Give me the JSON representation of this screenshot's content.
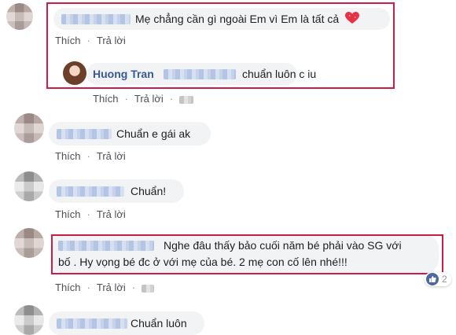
{
  "comments": [
    {
      "text": "Mẹ chẳng cần gì ngoài Em vì Em là tất cả",
      "emoji": "sparkling-heart-icon",
      "actions": {
        "like": "Thích",
        "reply": "Trả lời"
      },
      "reply": {
        "author": "Huong Tran",
        "text": "chuẩn luôn c iu",
        "actions": {
          "like": "Thích",
          "reply": "Trả lời"
        }
      }
    },
    {
      "text": "Chuẩn e gái ak",
      "actions": {
        "like": "Thích",
        "reply": "Trả lời"
      }
    },
    {
      "text": "Chuẩn!",
      "actions": {
        "like": "Thích",
        "reply": "Trả lời"
      }
    },
    {
      "text_line1": "Nghe đâu thấy bảo cuối năm bé phải vào SG với",
      "text_line2": "bố . Hy vọng bé đc ở với mẹ của bé. 2 mẹ con cố lên nhé!!!",
      "reactions": {
        "icon": "like-icon",
        "count": "2"
      },
      "actions": {
        "like": "Thích",
        "reply": "Trả lời"
      }
    },
    {
      "text": "Chuẩn luôn"
    }
  ],
  "colors": {
    "highlight": "#cf1c47",
    "link": "#385898",
    "bubble": "#f2f3f5"
  }
}
